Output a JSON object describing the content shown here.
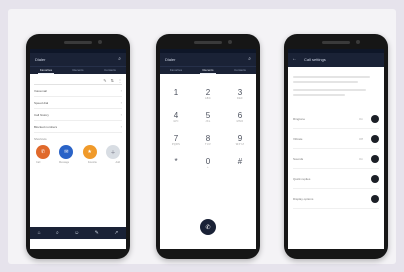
{
  "phones": [
    {
      "app_title": "Dialer",
      "tabs": [
        "Favorites",
        "Recents",
        "Contacts"
      ],
      "rows": [
        "Voicemail",
        "Speed dial",
        "Call history",
        "Blocked numbers"
      ],
      "section_label": "Shortcuts",
      "shortcuts": [
        {
          "glyph": "✆",
          "color": "#e0692b",
          "label": "Call"
        },
        {
          "glyph": "✉",
          "color": "#2a63c7",
          "label": "Message"
        },
        {
          "glyph": "★",
          "color": "#f09a2a",
          "label": "Favorite"
        },
        {
          "glyph": "＋",
          "color": "#d8dde3",
          "label": "Add"
        }
      ]
    },
    {
      "app_title": "Dialer",
      "tabs": [
        "Favorites",
        "Recents",
        "Contacts"
      ],
      "keys": [
        {
          "num": "1",
          "letters": ""
        },
        {
          "num": "2",
          "letters": "ABC"
        },
        {
          "num": "3",
          "letters": "DEF"
        },
        {
          "num": "4",
          "letters": "GHI"
        },
        {
          "num": "5",
          "letters": "JKL"
        },
        {
          "num": "6",
          "letters": "MNO"
        },
        {
          "num": "7",
          "letters": "PQRS"
        },
        {
          "num": "8",
          "letters": "TUV"
        },
        {
          "num": "9",
          "letters": "WXYZ"
        },
        {
          "num": "*",
          "letters": ""
        },
        {
          "num": "0",
          "letters": "+"
        },
        {
          "num": "#",
          "letters": ""
        }
      ]
    },
    {
      "app_title": "Call settings",
      "settings": [
        {
          "label": "Ringtone",
          "value": "On"
        },
        {
          "label": "Vibrate",
          "value": "Off"
        },
        {
          "label": "Sounds",
          "value": "On"
        },
        {
          "label": "Quick replies",
          "value": ""
        },
        {
          "label": "Display options",
          "value": ""
        }
      ]
    }
  ]
}
